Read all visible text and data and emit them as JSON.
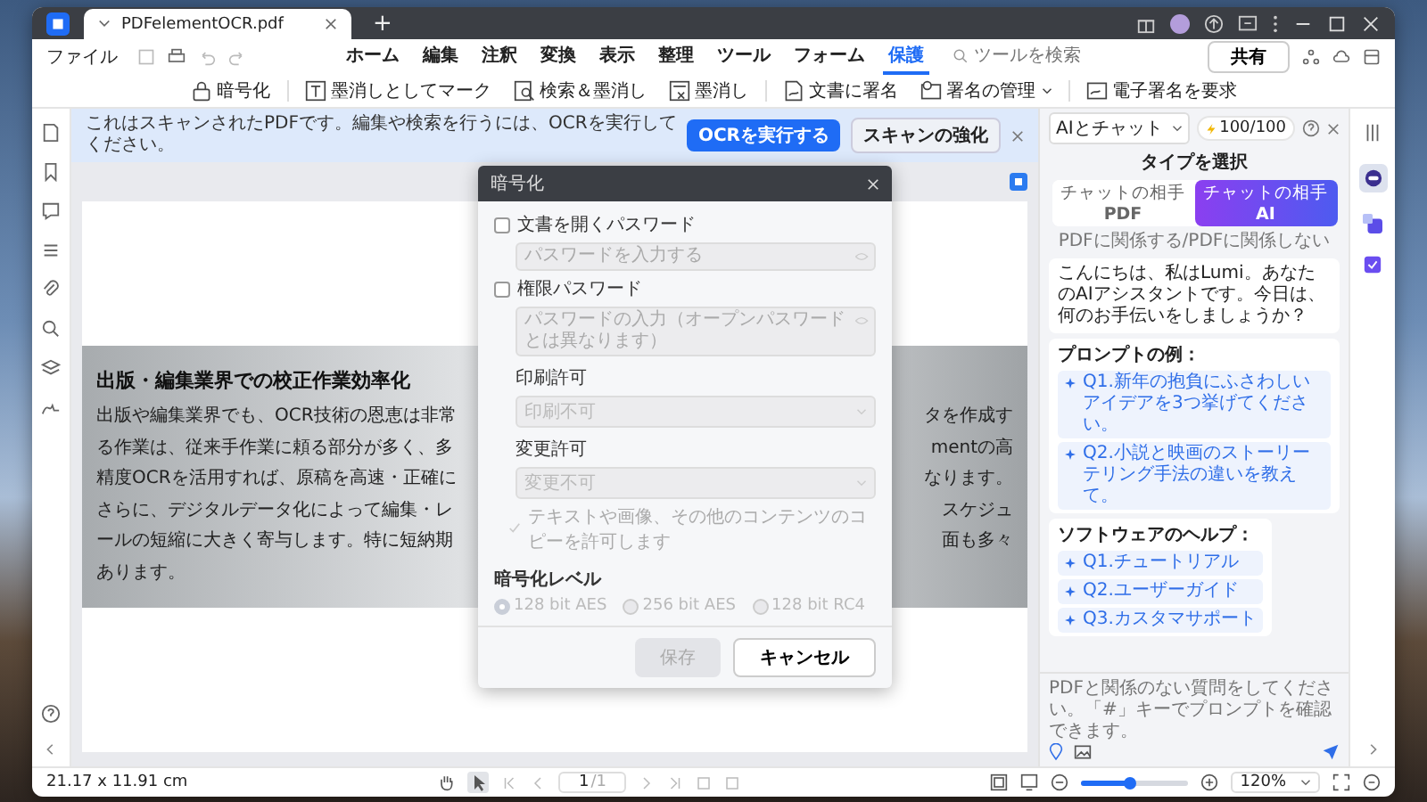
{
  "window": {
    "tab_title": "PDFelementOCR.pdf",
    "new_tab": "+"
  },
  "menu": {
    "file": "ファイル",
    "tabs": [
      {
        "label": "ホーム",
        "selected": false
      },
      {
        "label": "編集",
        "selected": false
      },
      {
        "label": "注釈",
        "selected": false
      },
      {
        "label": "変換",
        "selected": false
      },
      {
        "label": "表示",
        "selected": false
      },
      {
        "label": "整理",
        "selected": false
      },
      {
        "label": "ツール",
        "selected": false
      },
      {
        "label": "フォーム",
        "selected": false
      },
      {
        "label": "保護",
        "selected": true
      }
    ],
    "search": {
      "placeholder": "ツールを検索"
    },
    "share": "共有"
  },
  "toolbar": [
    {
      "kind": "lock",
      "label": "暗号化",
      "dropdown": false
    },
    {
      "kind": "mark",
      "label": "墨消しとしてマーク",
      "dropdown": false
    },
    {
      "kind": "find",
      "label": "検索＆墨消し",
      "dropdown": false
    },
    {
      "kind": "redact",
      "label": "墨消し",
      "dropdown": false
    },
    {
      "kind": "sign",
      "label": "文書に署名",
      "dropdown": false
    },
    {
      "kind": "manage",
      "label": "署名の管理",
      "dropdown": true
    },
    {
      "kind": "request",
      "label": "電子署名を要求",
      "dropdown": false
    }
  ],
  "banner": {
    "message": "これはスキャンされたPDFです。編集や検索を行うには、OCRを実行してください。",
    "primary_button": "OCRを実行する",
    "secondary_button": "スキャンの強化"
  },
  "document": {
    "title": "出版・編集業界での校正作業効率化",
    "lines": [
      {
        "left": "出版や編集業界でも、OCR技術の恩恵は非常",
        "right": "タを作成す"
      },
      {
        "left": "る作業は、従来手作業に頼る部分が多く、多",
        "right": "mentの高"
      },
      {
        "left": "精度OCRを活用すれば、原稿を高速・正確に",
        "right": "なります。"
      },
      {
        "left": "さらに、デジタルデータ化によって編集・レ",
        "right": "スケジュ"
      },
      {
        "left": "ールの短縮に大きく寄与します。特に短納期",
        "right": "面も多々"
      },
      {
        "left": "あります。"
      }
    ]
  },
  "dialog": {
    "title": "暗号化",
    "open_password": {
      "label": "文書を開くパスワード",
      "checked": false,
      "placeholder": "パスワードを入力する"
    },
    "permission_password": {
      "label": "権限パスワード",
      "checked": false,
      "placeholder": "パスワードの入力（オープンパスワードとは異なります）"
    },
    "print": {
      "label": "印刷許可",
      "value": "印刷不可"
    },
    "change": {
      "label": "変更許可",
      "value": "変更不可"
    },
    "copy": {
      "label": "テキストや画像、その他のコンテンツのコピーを許可します",
      "checked": true
    },
    "level_label": "暗号化レベル",
    "levels": [
      {
        "label": "128 bit AES",
        "selected": true
      },
      {
        "label": "256 bit AES",
        "selected": false
      },
      {
        "label": "128 bit RC4",
        "selected": false
      }
    ],
    "save": {
      "label": "保存",
      "disabled": true
    },
    "cancel": "キャンセル"
  },
  "ai_panel": {
    "mode": "AIとチャット",
    "credits": "100/100",
    "heading": "タイプを選択",
    "chat_types": [
      {
        "label": "チャットの相手",
        "target": "PDF",
        "selected": false
      },
      {
        "label": "チャットの相手",
        "target": "AI",
        "selected": true
      }
    ],
    "subtitle": "PDFに関係する/PDFに関係しない",
    "greeting": "こんにちは、私はLumi。あなたのAIアシスタントです。今日は、何のお手伝いをしましょうか？",
    "prompt_heading": "プロンプトの例：",
    "prompts": [
      "Q1.新年の抱負にふさわしいアイデアを3つ挙げてください。",
      "Q2.小説と映画のストーリーテリング手法の違いを教えて。"
    ],
    "help_heading": "ソフトウェアのヘルプ：",
    "help_items": [
      "Q1.チュートリアル",
      "Q2.ユーザーガイド",
      "Q3.カスタマサポート"
    ],
    "input": {
      "placeholder": "PDFと関係のない質問をしてください。「#」キーでプロンプトを確認できます。"
    }
  },
  "status_bar": {
    "dimensions": "21.17 x 11.91 cm",
    "page": "1",
    "page_total": "/1",
    "zoom": "120%",
    "zoom_slider": {
      "level": 0.45
    }
  }
}
